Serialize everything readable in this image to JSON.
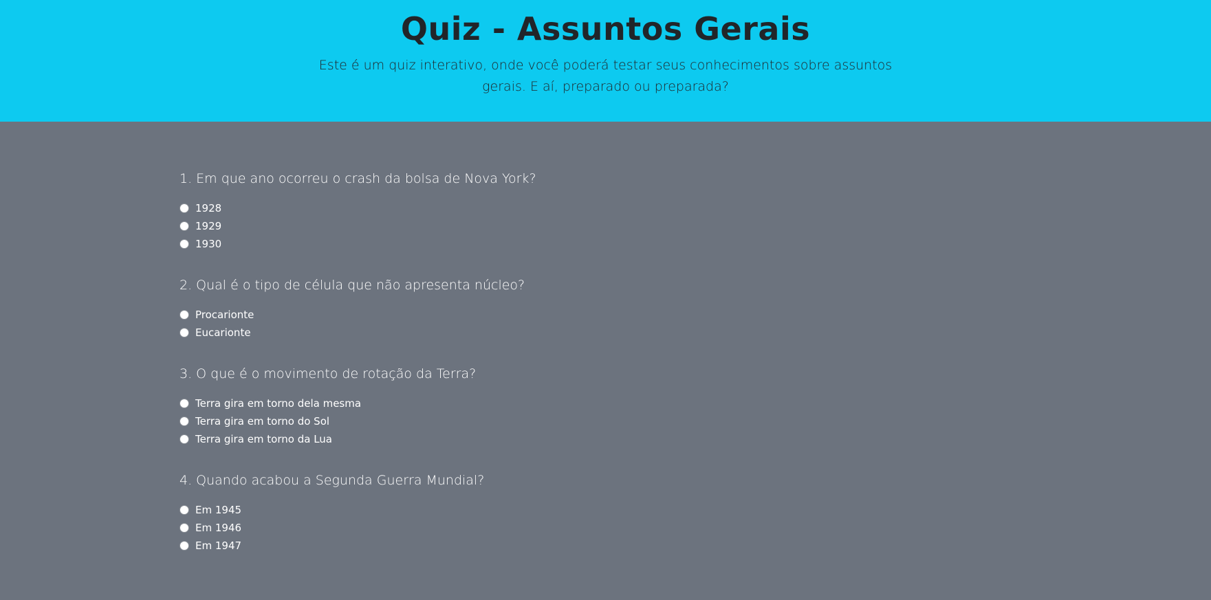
{
  "header": {
    "title": "Quiz - Assuntos Gerais",
    "subtitle": "Este é um quiz interativo, onde você poderá testar seus conhecimentos sobre assuntos gerais. E aí, preparado ou preparada?"
  },
  "colors": {
    "header_bg": "#0dcaf0",
    "page_bg": "#6c737e",
    "header_text": "#212529",
    "body_text": "#ffffff"
  },
  "questions": [
    {
      "text": "1. Em que ano ocorreu o crash da bolsa de Nova York?",
      "options": [
        "1928",
        "1929",
        "1930"
      ]
    },
    {
      "text": "2. Qual é o tipo de célula que não apresenta núcleo?",
      "options": [
        "Procarionte",
        "Eucarionte"
      ]
    },
    {
      "text": "3. O que é o movimento de rotação da Terra?",
      "options": [
        "Terra gira em torno dela mesma",
        "Terra gira em torno do Sol",
        "Terra gira em torno da Lua"
      ]
    },
    {
      "text": "4. Quando acabou a Segunda Guerra Mundial?",
      "options": [
        "Em 1945",
        "Em 1946",
        "Em 1947"
      ]
    }
  ]
}
